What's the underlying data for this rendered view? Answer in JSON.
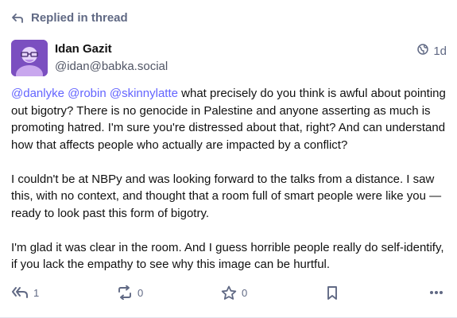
{
  "context": {
    "label": "Replied in thread",
    "icon": "reply-arrow-icon"
  },
  "author": {
    "display_name": "Idan Gazit",
    "handle": "@idan@babka.social",
    "avatar_color": "#7b4fc0"
  },
  "meta": {
    "visibility_icon": "globe-icon",
    "relative_time": "1d"
  },
  "post": {
    "mentions": [
      "@danlyke",
      "@robin",
      "@skinnylatte"
    ],
    "p1_text": " what precisely do you think is awful about pointing out bigotry? There is no genocide in Palestine and anyone asserting as much is promoting hatred. I'm sure you're distressed about that, right? And can understand how that affects people who actually are impacted by a conflict?",
    "p2": "I couldn't be at NBPy and was looking forward to the talks from a distance. I saw this, with no context, and thought that a room full of smart people were like you — ready to look past this form of bigotry.",
    "p3": "I'm glad it was clear in the room. And I guess horrible people really do self-identify, if you lack the empathy to see why this image can be hurtful.",
    "mention_color": "#6364ff"
  },
  "actions": {
    "reply": {
      "icon": "reply-all-icon",
      "count": "1"
    },
    "boost": {
      "icon": "boost-icon",
      "count": "0"
    },
    "favourite": {
      "icon": "star-icon",
      "count": "0"
    },
    "bookmark": {
      "icon": "bookmark-icon"
    },
    "more": {
      "icon": "more-icon"
    }
  }
}
